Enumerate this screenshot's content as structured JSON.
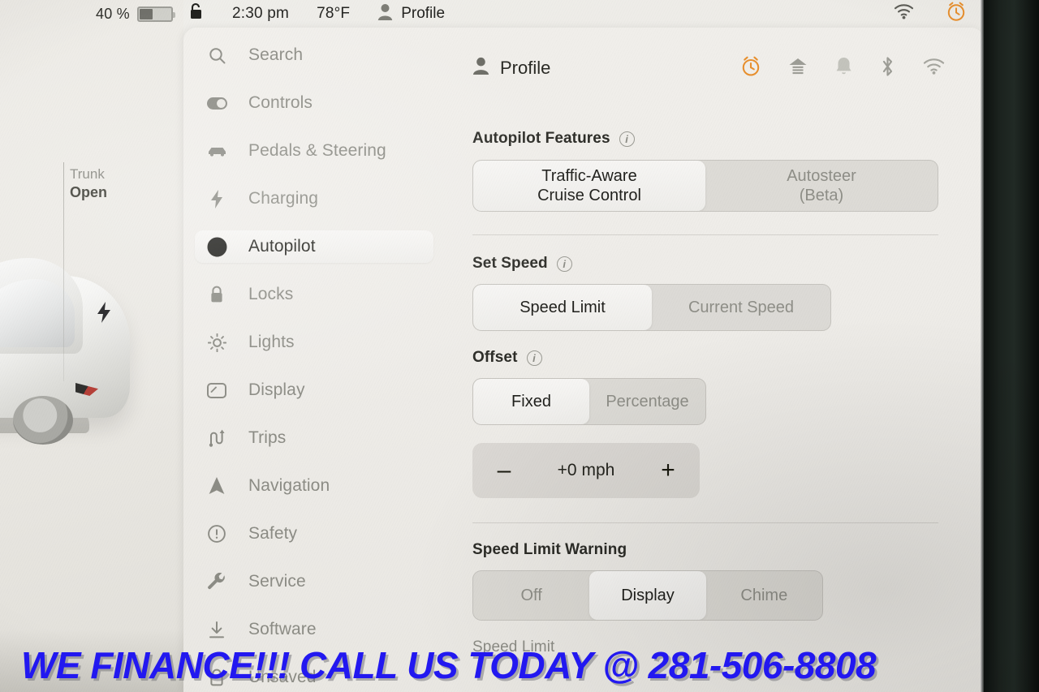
{
  "statusbar": {
    "battery_percent": "40 %",
    "battery_level": 40,
    "lock_icon": "unlocked-padlock-icon",
    "time": "2:30 pm",
    "temperature": "78°F",
    "profile_label": "Profile",
    "profile_icon": "person-icon",
    "right_icons": [
      "wifi-icon",
      "alarm-clock-icon"
    ]
  },
  "car_panel": {
    "status_title": "Trunk",
    "status_value": "Open",
    "charge_port_icon": "lightning-bolt-icon"
  },
  "menu": {
    "items": [
      {
        "label": "Search",
        "icon": "search-icon",
        "active": false
      },
      {
        "label": "Controls",
        "icon": "toggle-icon",
        "active": false
      },
      {
        "label": "Pedals & Steering",
        "icon": "car-icon",
        "active": false
      },
      {
        "label": "Charging",
        "icon": "bolt-icon",
        "active": false
      },
      {
        "label": "Autopilot",
        "icon": "steering-wheel-icon",
        "active": true
      },
      {
        "label": "Locks",
        "icon": "lock-icon",
        "active": false
      },
      {
        "label": "Lights",
        "icon": "sun-icon",
        "active": false
      },
      {
        "label": "Display",
        "icon": "display-icon",
        "active": false
      },
      {
        "label": "Trips",
        "icon": "route-icon",
        "active": false
      },
      {
        "label": "Navigation",
        "icon": "navigation-arrow-icon",
        "active": false
      },
      {
        "label": "Safety",
        "icon": "exclamation-circle-icon",
        "active": false
      },
      {
        "label": "Service",
        "icon": "wrench-icon",
        "active": false
      },
      {
        "label": "Software",
        "icon": "download-icon",
        "active": false
      },
      {
        "label": "Unsaved",
        "icon": "lock-open-icon",
        "active": false
      }
    ]
  },
  "content": {
    "header": {
      "profile_label": "Profile",
      "profile_icon": "person-icon",
      "icons": [
        "alarm-clock-icon",
        "garage-icon",
        "bell-icon",
        "bluetooth-icon",
        "wifi-icon"
      ],
      "alarm_color": "#e8902f"
    },
    "sections": [
      {
        "title": "Autopilot Features",
        "has_info": true,
        "options": [
          "Traffic-Aware\nCruise Control",
          "Autosteer\n(Beta)"
        ],
        "option_lines": [
          [
            "Traffic-Aware",
            "Cruise Control"
          ],
          [
            "Autosteer",
            "(Beta)"
          ]
        ],
        "selected": 0
      },
      {
        "title": "Set Speed",
        "has_info": true,
        "options": [
          "Speed Limit",
          "Current Speed"
        ],
        "option_lines": [
          [
            "Speed Limit"
          ],
          [
            "Current Speed"
          ]
        ],
        "selected": 0
      },
      {
        "title": "Offset",
        "has_info": true,
        "options": [
          "Fixed",
          "Percentage"
        ],
        "option_lines": [
          [
            "Fixed"
          ],
          [
            "Percentage"
          ]
        ],
        "selected": 0
      }
    ],
    "stepper": {
      "minus_label": "–",
      "value": "+0 mph",
      "plus_label": "+"
    },
    "warning": {
      "title": "Speed Limit Warning",
      "has_info": false,
      "options": [
        "Off",
        "Display",
        "Chime"
      ],
      "selected": 1
    },
    "next_section_title": "Speed Limit"
  },
  "overlay": {
    "dealer_text": "WE FINANCE!!! CALL US TODAY @ 281-506-8808",
    "color": "#2218f0"
  }
}
